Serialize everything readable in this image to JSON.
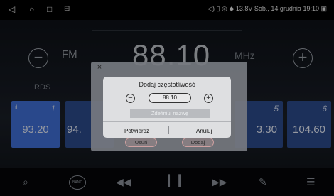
{
  "status_bar": {
    "icons": [
      "back-icon",
      "home-icon",
      "recents-icon",
      "screen-mode-icon"
    ],
    "indicators": [
      "volume-icon",
      "vibrate-icon",
      "location-icon",
      "wifi-icon"
    ],
    "battery_voltage": "13.8V",
    "datetime": "Sob., 14 grudnia 19:10"
  },
  "radio": {
    "band": "FM",
    "frequency": "88.10",
    "unit": "MHz",
    "rds": "RDS"
  },
  "presets": [
    {
      "num": "1",
      "freq": "93.20",
      "active": true
    },
    {
      "num": "",
      "freq": "94.",
      "active": false
    },
    {
      "num": "5",
      "freq": "3.30",
      "active": false
    },
    {
      "num": "6",
      "freq": "104.60",
      "active": false
    }
  ],
  "toolbar": [
    "search-icon",
    "band-icon",
    "seek-back-icon",
    "pause-icon",
    "seek-forward-icon",
    "edit-icon",
    "settings-icon"
  ],
  "toolbar_labels": {
    "band": "BAND"
  },
  "dialog": {
    "title": "Dodaj częstotliwość",
    "decrement": "−",
    "increment": "+",
    "frequency_value": "88.10",
    "name_placeholder": "Zdefiniuj nazwę",
    "confirm": "Potwierdź",
    "cancel": "Anuluj",
    "close": "×"
  },
  "under_dialog_buttons": {
    "remove": "Usuń",
    "add": "Dodaj"
  },
  "colors": {
    "preset_active": "#3f6fd6",
    "preset": "#2c4a8a",
    "dialog_bg": "#dedfe1"
  }
}
